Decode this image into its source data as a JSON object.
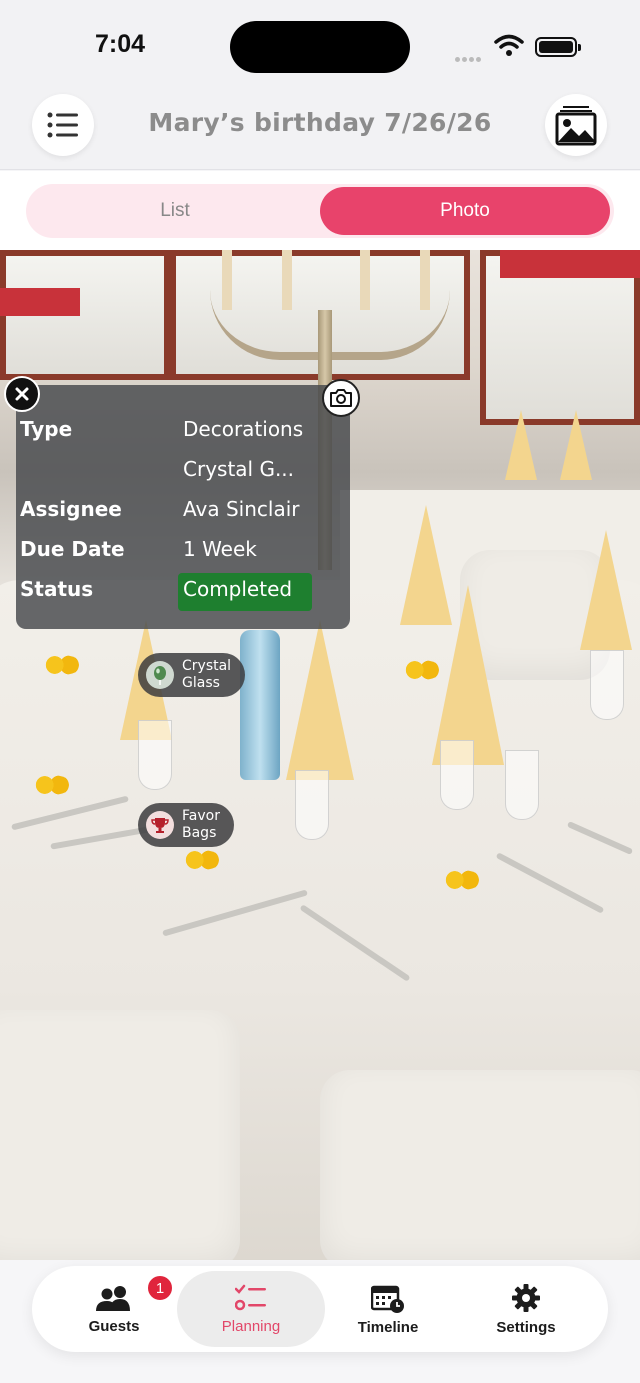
{
  "status_bar": {
    "time": "7:04"
  },
  "header": {
    "title": "Mary’s birthday 7/26/26",
    "menu_icon": "list-icon",
    "photo_icon": "image-icon"
  },
  "segmented": {
    "list_label": "List",
    "photo_label": "Photo",
    "selected": "Photo"
  },
  "info_card": {
    "type_label": "Type",
    "type_value": "Decorations",
    "name_value": "Crystal G...",
    "assignee_label": "Assignee",
    "assignee_value": "Ava Sinclair",
    "due_label": "Due Date",
    "due_value": "1 Week",
    "status_label": "Status",
    "status_value": "Completed"
  },
  "tags": [
    {
      "line1": "Crystal",
      "line2": "Glass",
      "icon": "balloon-icon"
    },
    {
      "line1": "Favor",
      "line2": "Bags",
      "icon": "trophy-icon"
    }
  ],
  "bottom_nav": {
    "guests": "Guests",
    "guests_badge": "1",
    "planning": "Planning",
    "timeline": "Timeline",
    "settings": "Settings",
    "active": "Planning"
  },
  "colors": {
    "accent": "#e8436b",
    "status_completed": "#1e7f2f",
    "badge": "#e0253c"
  }
}
